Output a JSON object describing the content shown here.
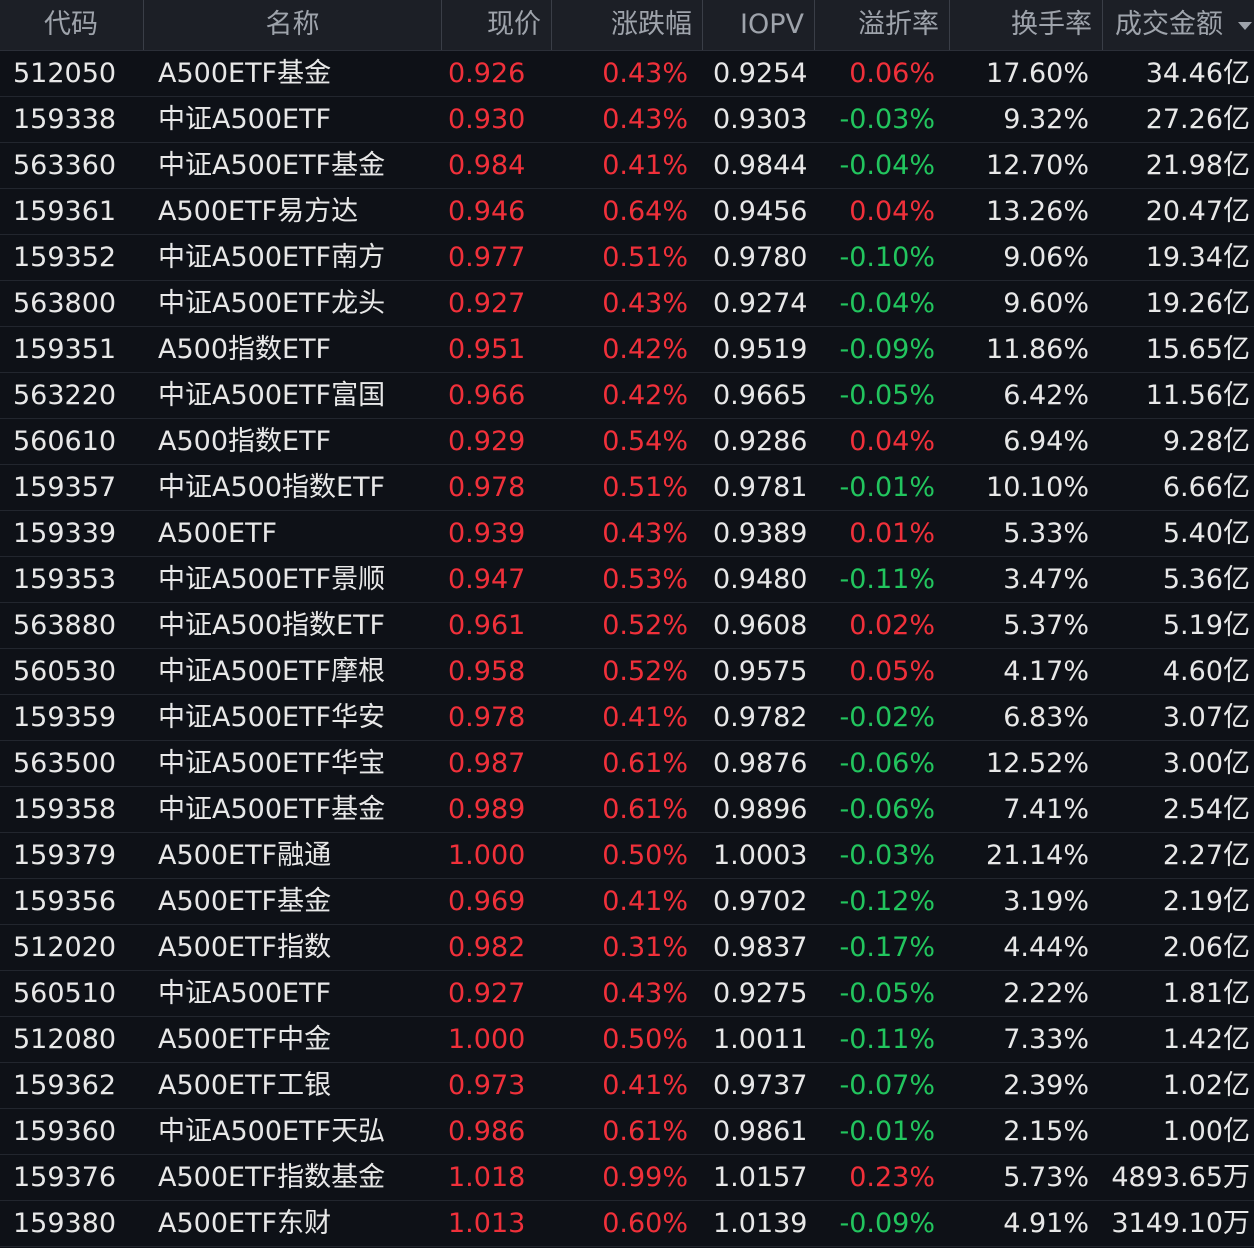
{
  "colors": {
    "up": "#f0303a",
    "down": "#22c55e",
    "header_bg": "#1c1f26",
    "bg": "#0e1117"
  },
  "header": {
    "code": "代码",
    "name": "名称",
    "price": "现价",
    "change": "涨跌幅",
    "iopv": "IOPV",
    "premium": "溢折率",
    "turnover": "换手率",
    "amount": "成交金额",
    "sort_icon": "sort-down-icon"
  },
  "rows": [
    {
      "code": "512050",
      "name": "A500ETF基金",
      "price": "0.926",
      "change": "0.43%",
      "iopv": "0.9254",
      "premium": "0.06%",
      "premium_dir": "up",
      "turnover": "17.60%",
      "amount": "34.46亿"
    },
    {
      "code": "159338",
      "name": "中证A500ETF",
      "price": "0.930",
      "change": "0.43%",
      "iopv": "0.9303",
      "premium": "-0.03%",
      "premium_dir": "down",
      "turnover": "9.32%",
      "amount": "27.26亿"
    },
    {
      "code": "563360",
      "name": "中证A500ETF基金",
      "price": "0.984",
      "change": "0.41%",
      "iopv": "0.9844",
      "premium": "-0.04%",
      "premium_dir": "down",
      "turnover": "12.70%",
      "amount": "21.98亿"
    },
    {
      "code": "159361",
      "name": "A500ETF易方达",
      "price": "0.946",
      "change": "0.64%",
      "iopv": "0.9456",
      "premium": "0.04%",
      "premium_dir": "up",
      "turnover": "13.26%",
      "amount": "20.47亿"
    },
    {
      "code": "159352",
      "name": "中证A500ETF南方",
      "price": "0.977",
      "change": "0.51%",
      "iopv": "0.9780",
      "premium": "-0.10%",
      "premium_dir": "down",
      "turnover": "9.06%",
      "amount": "19.34亿"
    },
    {
      "code": "563800",
      "name": "中证A500ETF龙头",
      "price": "0.927",
      "change": "0.43%",
      "iopv": "0.9274",
      "premium": "-0.04%",
      "premium_dir": "down",
      "turnover": "9.60%",
      "amount": "19.26亿"
    },
    {
      "code": "159351",
      "name": "A500指数ETF",
      "price": "0.951",
      "change": "0.42%",
      "iopv": "0.9519",
      "premium": "-0.09%",
      "premium_dir": "down",
      "turnover": "11.86%",
      "amount": "15.65亿"
    },
    {
      "code": "563220",
      "name": "中证A500ETF富国",
      "price": "0.966",
      "change": "0.42%",
      "iopv": "0.9665",
      "premium": "-0.05%",
      "premium_dir": "down",
      "turnover": "6.42%",
      "amount": "11.56亿"
    },
    {
      "code": "560610",
      "name": "A500指数ETF",
      "price": "0.929",
      "change": "0.54%",
      "iopv": "0.9286",
      "premium": "0.04%",
      "premium_dir": "up",
      "turnover": "6.94%",
      "amount": "9.28亿"
    },
    {
      "code": "159357",
      "name": "中证A500指数ETF",
      "price": "0.978",
      "change": "0.51%",
      "iopv": "0.9781",
      "premium": "-0.01%",
      "premium_dir": "down",
      "turnover": "10.10%",
      "amount": "6.66亿"
    },
    {
      "code": "159339",
      "name": "A500ETF",
      "price": "0.939",
      "change": "0.43%",
      "iopv": "0.9389",
      "premium": "0.01%",
      "premium_dir": "up",
      "turnover": "5.33%",
      "amount": "5.40亿"
    },
    {
      "code": "159353",
      "name": "中证A500ETF景顺",
      "price": "0.947",
      "change": "0.53%",
      "iopv": "0.9480",
      "premium": "-0.11%",
      "premium_dir": "down",
      "turnover": "3.47%",
      "amount": "5.36亿"
    },
    {
      "code": "563880",
      "name": "中证A500指数ETF",
      "price": "0.961",
      "change": "0.52%",
      "iopv": "0.9608",
      "premium": "0.02%",
      "premium_dir": "up",
      "turnover": "5.37%",
      "amount": "5.19亿"
    },
    {
      "code": "560530",
      "name": "中证A500ETF摩根",
      "price": "0.958",
      "change": "0.52%",
      "iopv": "0.9575",
      "premium": "0.05%",
      "premium_dir": "up",
      "turnover": "4.17%",
      "amount": "4.60亿"
    },
    {
      "code": "159359",
      "name": "中证A500ETF华安",
      "price": "0.978",
      "change": "0.41%",
      "iopv": "0.9782",
      "premium": "-0.02%",
      "premium_dir": "down",
      "turnover": "6.83%",
      "amount": "3.07亿"
    },
    {
      "code": "563500",
      "name": "中证A500ETF华宝",
      "price": "0.987",
      "change": "0.61%",
      "iopv": "0.9876",
      "premium": "-0.06%",
      "premium_dir": "down",
      "turnover": "12.52%",
      "amount": "3.00亿"
    },
    {
      "code": "159358",
      "name": "中证A500ETF基金",
      "price": "0.989",
      "change": "0.61%",
      "iopv": "0.9896",
      "premium": "-0.06%",
      "premium_dir": "down",
      "turnover": "7.41%",
      "amount": "2.54亿"
    },
    {
      "code": "159379",
      "name": "A500ETF融通",
      "price": "1.000",
      "change": "0.50%",
      "iopv": "1.0003",
      "premium": "-0.03%",
      "premium_dir": "down",
      "turnover": "21.14%",
      "amount": "2.27亿"
    },
    {
      "code": "159356",
      "name": "A500ETF基金",
      "price": "0.969",
      "change": "0.41%",
      "iopv": "0.9702",
      "premium": "-0.12%",
      "premium_dir": "down",
      "turnover": "3.19%",
      "amount": "2.19亿"
    },
    {
      "code": "512020",
      "name": "A500ETF指数",
      "price": "0.982",
      "change": "0.31%",
      "iopv": "0.9837",
      "premium": "-0.17%",
      "premium_dir": "down",
      "turnover": "4.44%",
      "amount": "2.06亿"
    },
    {
      "code": "560510",
      "name": "中证A500ETF",
      "price": "0.927",
      "change": "0.43%",
      "iopv": "0.9275",
      "premium": "-0.05%",
      "premium_dir": "down",
      "turnover": "2.22%",
      "amount": "1.81亿"
    },
    {
      "code": "512080",
      "name": "A500ETF中金",
      "price": "1.000",
      "change": "0.50%",
      "iopv": "1.0011",
      "premium": "-0.11%",
      "premium_dir": "down",
      "turnover": "7.33%",
      "amount": "1.42亿"
    },
    {
      "code": "159362",
      "name": "A500ETF工银",
      "price": "0.973",
      "change": "0.41%",
      "iopv": "0.9737",
      "premium": "-0.07%",
      "premium_dir": "down",
      "turnover": "2.39%",
      "amount": "1.02亿"
    },
    {
      "code": "159360",
      "name": "中证A500ETF天弘",
      "price": "0.986",
      "change": "0.61%",
      "iopv": "0.9861",
      "premium": "-0.01%",
      "premium_dir": "down",
      "turnover": "2.15%",
      "amount": "1.00亿"
    },
    {
      "code": "159376",
      "name": "A500ETF指数基金",
      "price": "1.018",
      "change": "0.99%",
      "iopv": "1.0157",
      "premium": "0.23%",
      "premium_dir": "up",
      "turnover": "5.73%",
      "amount": "4893.65万"
    },
    {
      "code": "159380",
      "name": "A500ETF东财",
      "price": "1.013",
      "change": "0.60%",
      "iopv": "1.0139",
      "premium": "-0.09%",
      "premium_dir": "down",
      "turnover": "4.91%",
      "amount": "3149.10万"
    }
  ]
}
